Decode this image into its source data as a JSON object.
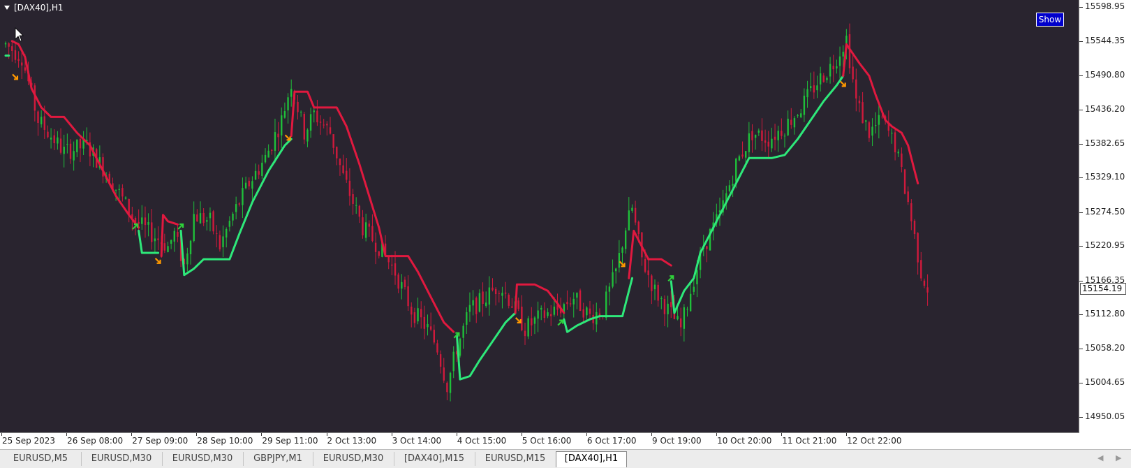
{
  "window": {
    "title": "[DAX40],H1",
    "show_button": "Show",
    "background_color": "#29242f",
    "bull_candle_color": "#1fbf3a",
    "bear_candle_color": "#d01a3c",
    "up_line_color": "#2ee87a",
    "down_line_color": "#e0193f",
    "sell_arrow_color": "#ff9900",
    "buy_arrow_color": "#2fd23a",
    "cursor_icon": "mouse-pointer-icon"
  },
  "price_axis": {
    "labels": [
      "15598.95",
      "15544.35",
      "15490.80",
      "15436.20",
      "15382.65",
      "15329.10",
      "15274.50",
      "15220.95",
      "15166.35",
      "15112.80",
      "15058.20",
      "15004.65",
      "14950.05"
    ],
    "current_price": "15154.19"
  },
  "time_axis": {
    "labels": [
      "25 Sep 2023",
      "26 Sep 08:00",
      "27 Sep 09:00",
      "28 Sep 10:00",
      "29 Sep 11:00",
      "2 Oct 13:00",
      "3 Oct 14:00",
      "4 Oct 15:00",
      "5 Oct 16:00",
      "6 Oct 17:00",
      "9 Oct 19:00",
      "10 Oct 20:00",
      "11 Oct 21:00",
      "12 Oct 22:00"
    ]
  },
  "chart_data": {
    "type": "candlestick",
    "symbol": "DAX40",
    "timeframe": "H1",
    "ylim": [
      14925,
      15610
    ],
    "price_path": [
      [
        0,
        15540
      ],
      [
        5,
        15520
      ],
      [
        10,
        15420
      ],
      [
        18,
        15370
      ],
      [
        25,
        15380
      ],
      [
        32,
        15330
      ],
      [
        40,
        15260
      ],
      [
        45,
        15240
      ],
      [
        50,
        15220
      ],
      [
        52,
        15240
      ],
      [
        55,
        15190
      ],
      [
        58,
        15270
      ],
      [
        63,
        15260
      ],
      [
        66,
        15220
      ],
      [
        70,
        15270
      ],
      [
        75,
        15320
      ],
      [
        80,
        15360
      ],
      [
        85,
        15420
      ],
      [
        88,
        15480
      ],
      [
        92,
        15400
      ],
      [
        95,
        15430
      ],
      [
        100,
        15400
      ],
      [
        104,
        15330
      ],
      [
        110,
        15250
      ],
      [
        115,
        15220
      ],
      [
        120,
        15180
      ],
      [
        125,
        15120
      ],
      [
        130,
        15090
      ],
      [
        133,
        15060
      ],
      [
        136,
        15000
      ],
      [
        139,
        15060
      ],
      [
        143,
        15120
      ],
      [
        148,
        15140
      ],
      [
        152,
        15160
      ],
      [
        156,
        15130
      ],
      [
        160,
        15090
      ],
      [
        165,
        15110
      ],
      [
        170,
        15120
      ],
      [
        175,
        15140
      ],
      [
        180,
        15110
      ],
      [
        184,
        15120
      ],
      [
        188,
        15180
      ],
      [
        191,
        15250
      ],
      [
        193,
        15280
      ],
      [
        196,
        15200
      ],
      [
        200,
        15150
      ],
      [
        204,
        15120
      ],
      [
        208,
        15090
      ],
      [
        212,
        15170
      ],
      [
        215,
        15220
      ],
      [
        220,
        15270
      ],
      [
        225,
        15350
      ],
      [
        230,
        15400
      ],
      [
        235,
        15390
      ],
      [
        240,
        15410
      ],
      [
        245,
        15440
      ],
      [
        250,
        15480
      ],
      [
        255,
        15510
      ],
      [
        259,
        15550
      ],
      [
        262,
        15450
      ],
      [
        266,
        15400
      ],
      [
        270,
        15420
      ],
      [
        274,
        15380
      ],
      [
        278,
        15290
      ],
      [
        282,
        15180
      ],
      [
        284,
        15154
      ]
    ],
    "up_line": [
      [
        0,
        15522
      ],
      [
        1,
        15522
      ],
      [
        null,
        null
      ],
      [
        41,
        15245
      ],
      [
        42,
        15210
      ],
      [
        47,
        15210
      ],
      [
        null,
        null
      ],
      [
        54,
        15245
      ],
      [
        55,
        15175
      ],
      [
        58,
        15185
      ],
      [
        61,
        15200
      ],
      [
        69,
        15200
      ],
      [
        72,
        15240
      ],
      [
        76,
        15290
      ],
      [
        81,
        15340
      ],
      [
        86,
        15380
      ],
      [
        88,
        15390
      ],
      [
        null,
        null
      ],
      [
        139,
        15080
      ],
      [
        140,
        15010
      ],
      [
        143,
        15015
      ],
      [
        146,
        15040
      ],
      [
        150,
        15070
      ],
      [
        154,
        15100
      ],
      [
        157,
        15115
      ],
      [
        null,
        null
      ],
      [
        172,
        15105
      ],
      [
        173,
        15085
      ],
      [
        176,
        15095
      ],
      [
        180,
        15105
      ],
      [
        183,
        15110
      ],
      [
        190,
        15110
      ],
      [
        193,
        15170
      ],
      [
        null,
        null
      ],
      [
        205,
        15165
      ],
      [
        206,
        15115
      ],
      [
        209,
        15150
      ],
      [
        212,
        15170
      ],
      [
        214,
        15210
      ],
      [
        217,
        15240
      ],
      [
        220,
        15270
      ],
      [
        225,
        15320
      ],
      [
        229,
        15360
      ],
      [
        236,
        15360
      ],
      [
        240,
        15365
      ],
      [
        244,
        15390
      ],
      [
        248,
        15420
      ],
      [
        252,
        15450
      ],
      [
        256,
        15475
      ],
      [
        258,
        15490
      ]
    ],
    "down_line": [
      [
        2,
        15545
      ],
      [
        4,
        15540
      ],
      [
        6,
        15520
      ],
      [
        8,
        15470
      ],
      [
        11,
        15440
      ],
      [
        14,
        15425
      ],
      [
        18,
        15425
      ],
      [
        22,
        15400
      ],
      [
        26,
        15380
      ],
      [
        30,
        15340
      ],
      [
        34,
        15300
      ],
      [
        38,
        15270
      ],
      [
        41,
        15250
      ],
      [
        null,
        null
      ],
      [
        48,
        15205
      ],
      [
        48.5,
        15270
      ],
      [
        50,
        15260
      ],
      [
        53,
        15255
      ],
      [
        null,
        null
      ],
      [
        88,
        15395
      ],
      [
        89,
        15465
      ],
      [
        93,
        15465
      ],
      [
        95,
        15440
      ],
      [
        102,
        15440
      ],
      [
        105,
        15410
      ],
      [
        109,
        15350
      ],
      [
        112,
        15300
      ],
      [
        115,
        15250
      ],
      [
        117,
        15205
      ],
      [
        124,
        15205
      ],
      [
        127,
        15180
      ],
      [
        131,
        15140
      ],
      [
        135,
        15100
      ],
      [
        138,
        15085
      ],
      [
        null,
        null
      ],
      [
        157,
        15115
      ],
      [
        157.5,
        15160
      ],
      [
        163,
        15160
      ],
      [
        167,
        15150
      ],
      [
        170,
        15130
      ],
      [
        172,
        15115
      ],
      [
        null,
        null
      ],
      [
        192,
        15170
      ],
      [
        193.5,
        15245
      ],
      [
        196,
        15220
      ],
      [
        198,
        15200
      ],
      [
        202,
        15200
      ],
      [
        205,
        15190
      ],
      [
        null,
        null
      ],
      [
        258,
        15490
      ],
      [
        259,
        15540
      ],
      [
        263,
        15510
      ],
      [
        266,
        15490
      ],
      [
        268,
        15460
      ],
      [
        271,
        15420
      ],
      [
        273,
        15410
      ],
      [
        276,
        15400
      ],
      [
        278,
        15380
      ],
      [
        280,
        15340
      ],
      [
        281,
        15320
      ]
    ],
    "sell_arrows": [
      [
        3,
        15488
      ],
      [
        87,
        15392
      ],
      [
        47,
        15197
      ],
      [
        158,
        15103
      ],
      [
        190,
        15192
      ],
      [
        258,
        15477
      ]
    ],
    "buy_arrows": [
      [
        40,
        15252
      ],
      [
        54,
        15252
      ],
      [
        139,
        15080
      ],
      [
        171,
        15100
      ],
      [
        205,
        15170
      ]
    ]
  },
  "tabs": [
    {
      "label": "EURUSD,M5",
      "active": false
    },
    {
      "label": "EURUSD,M30",
      "active": false
    },
    {
      "label": "EURUSD,M30",
      "active": false
    },
    {
      "label": "GBPJPY,M1",
      "active": false
    },
    {
      "label": "EURUSD,M30",
      "active": false
    },
    {
      "label": "[DAX40],M15",
      "active": false
    },
    {
      "label": "EURUSD,M15",
      "active": false
    },
    {
      "label": "[DAX40],H1",
      "active": true
    }
  ],
  "tab_nav": {
    "left": "◀",
    "right": "▶"
  }
}
